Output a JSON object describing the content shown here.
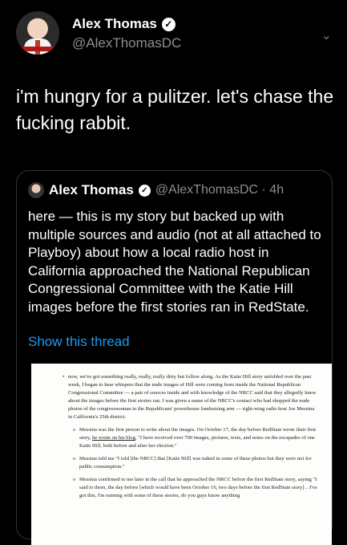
{
  "author": {
    "name": "Alex Thomas",
    "handle": "@AlexThomasDC",
    "verified_mark": "✓"
  },
  "menu_caret": "⌄",
  "tweet_text": "i'm hungry for a pulitzer. let's chase the fucking rabbit.",
  "quoted": {
    "name": "Alex Thomas",
    "verified_mark": "✓",
    "handle_time": "@AlexThomasDC · 4h",
    "text": "here — this is my story but backed up with multiple sources and audio (not at all attached to Playboy) about how a local radio host in California approached the National Republican Congressional Committee with the Katie Hill images before the first stories ran in RedState.",
    "show_thread": "Show this thread"
  },
  "document": {
    "para1": "now, we've got something really, really, really dirty but follow along. As the Katie Hill story unfolded over the past week, I began to hear whispers that the nude images of Hill were coming from inside the National Republican Congressional Committee — a pair of sources inside and with knowledge of the NRCC said that they allegedly knew about the images before the first stories ran. I was given a name of the NRCC's contact who had shopped the nude photos of the congresswoman to the Republicans' powerhouse fundraising arm — right-wing radio host Joe Messina in California's 25th district.",
    "para2_a": "Messina was the first person to write about the images. On October 17, the day before RedState wrote their first story, ",
    "para2_link": "he wrote on his blog",
    "para2_b": ", \"I have received over 700 images, pictures, texts, and notes on the escapades of one Katie Hill, both before and after her election.\"",
    "para3": "Messina told me \"I told [the NRCC] that [Katie Hill] was naked in some of these photos but they were not for public consumption.\"",
    "para4": "Messina confirmed to me later in the call that he approached the NRCC before the first RedState story, saying \"I said to them, the day before [which would have been October 16, two days before the first RedState story] .. I've got this, I'm running with some of these stories, do you guys know anything"
  }
}
